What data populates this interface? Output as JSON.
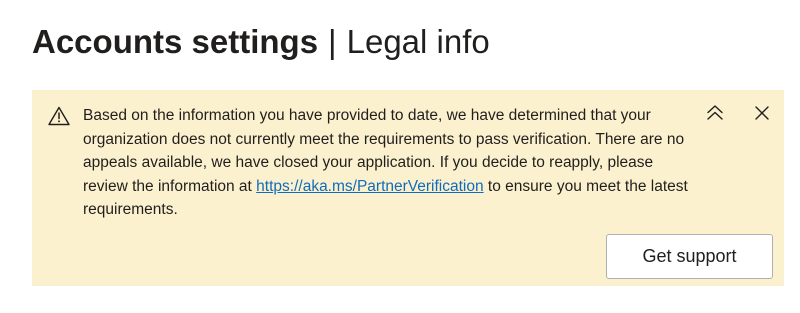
{
  "header": {
    "title": "Accounts settings",
    "separator": "|",
    "subtitle": "Legal info"
  },
  "banner": {
    "background_color": "#fcf1ce",
    "icon": "warning-triangle-icon",
    "message_before_link": "Based on the information you have provided to date, we have determined that your organization does not currently meet the requirements to pass verification. There are no appeals available, we have closed your application. If you decide to reapply, please review the information at ",
    "link_text": "https://aka.ms/PartnerVerification",
    "message_after_link": " to ensure you meet the latest requirements.",
    "link_color": "#0f6cbd",
    "collapse_icon": "chevron-double-up-icon",
    "close_icon": "close-icon",
    "support_button_label": "Get support"
  }
}
